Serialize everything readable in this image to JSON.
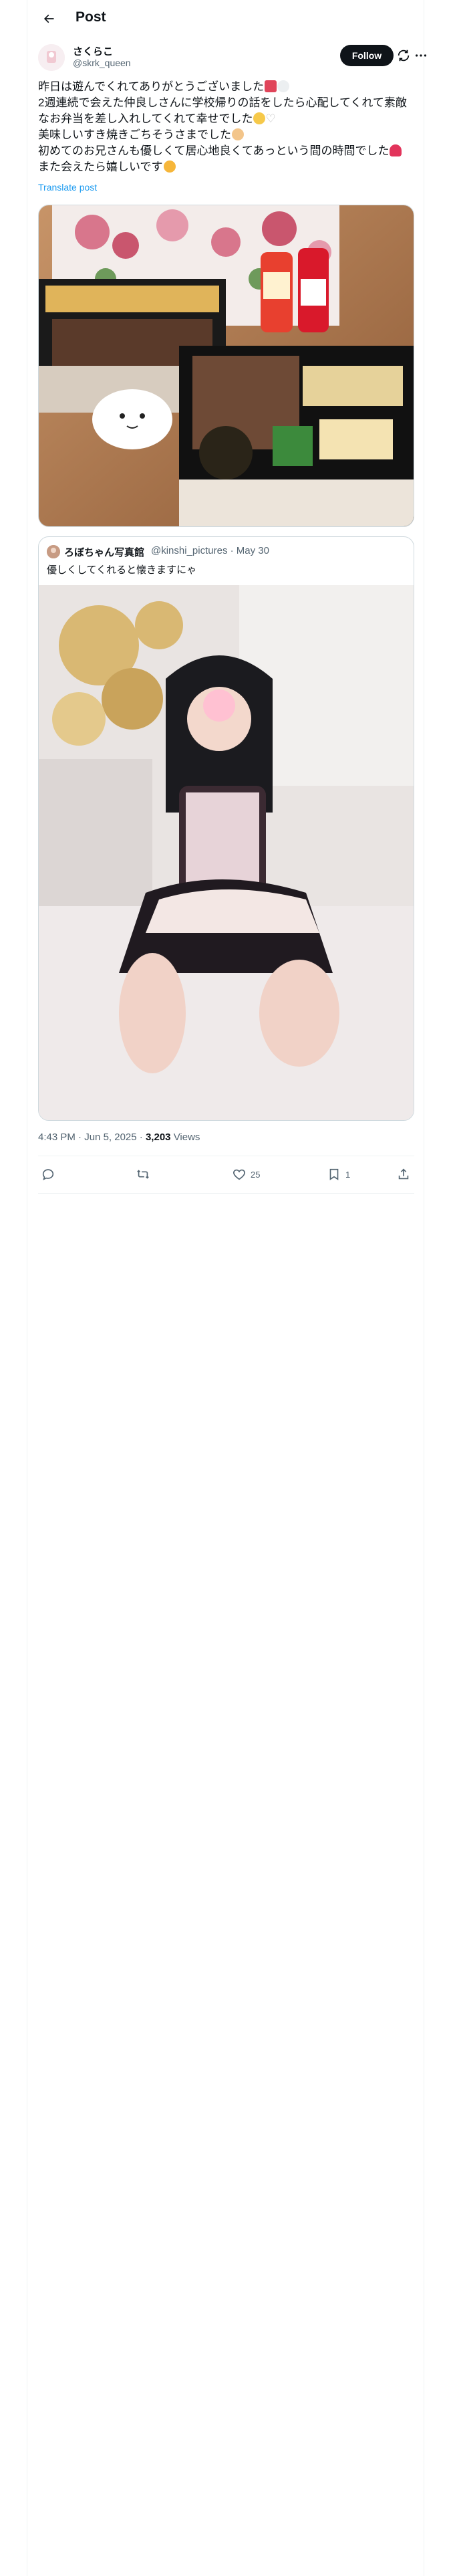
{
  "header": {
    "title": "Post",
    "back_icon": "arrow-left-icon"
  },
  "author": {
    "display_name": "さくらこ",
    "handle": "@skrk_queen",
    "follow_label": "Follow"
  },
  "tweet": {
    "lines": [
      "昨日は遊んでくれてありがとうございました",
      "2週連続で会えた仲良しさんに学校帰りの話をしたら心配してくれて素敵",
      "なお弁当を差し入れしてくれて幸せでした",
      "美味しいすき焼きごちそうさまでした",
      "初めてのお兄さんも優しくて居心地良くてあっという間の時間でした",
      "また会えたら嬉しいです"
    ],
    "translate_label": "Translate post"
  },
  "quote": {
    "name": "ろぼちゃん写真館",
    "handle": "@kinshi_pictures",
    "date": "May 30",
    "text": "優しくしてくれると懐きますにゃ"
  },
  "meta": {
    "time": "4:43 PM",
    "date": "Jun 5, 2025",
    "views_count": "3,203",
    "views_label": "Views"
  },
  "actions": {
    "reply_count": "",
    "repost_count": "",
    "like_count": "25",
    "bookmark_count": "1"
  },
  "colors": {
    "accent": "#1d9bf0",
    "text": "#0f1419",
    "muted": "#536471",
    "border": "#cfd9de",
    "follow_bg": "#0f1419"
  }
}
